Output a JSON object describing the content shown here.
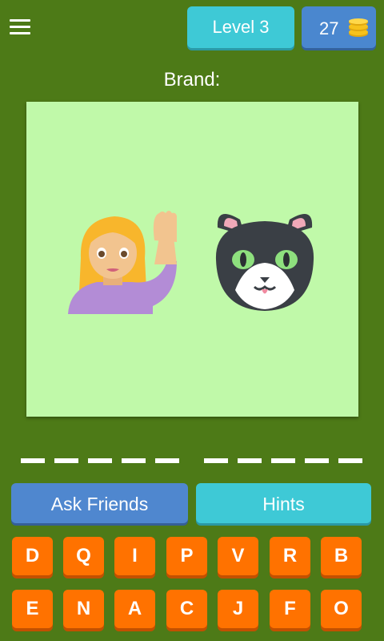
{
  "header": {
    "level_label": "Level 3",
    "coins": "27"
  },
  "prompt": "Brand:",
  "puzzle": {
    "background": "#c0f9a9",
    "emojis": [
      "person-raising-hand-emoji",
      "cat-face-emoji"
    ]
  },
  "answer": {
    "word_lengths": [
      5,
      5
    ]
  },
  "buttons": {
    "ask_friends": "Ask Friends",
    "hints": "Hints"
  },
  "keyboard": {
    "row1": [
      "D",
      "Q",
      "I",
      "P",
      "V",
      "R",
      "B"
    ],
    "row2": [
      "E",
      "N",
      "A",
      "C",
      "J",
      "F",
      "O"
    ]
  },
  "colors": {
    "background": "#4d7a17",
    "level_badge": "#3ec9d6",
    "coins_badge": "#4a87cf",
    "key": "#ff7200",
    "coin": "#f6c21c"
  }
}
